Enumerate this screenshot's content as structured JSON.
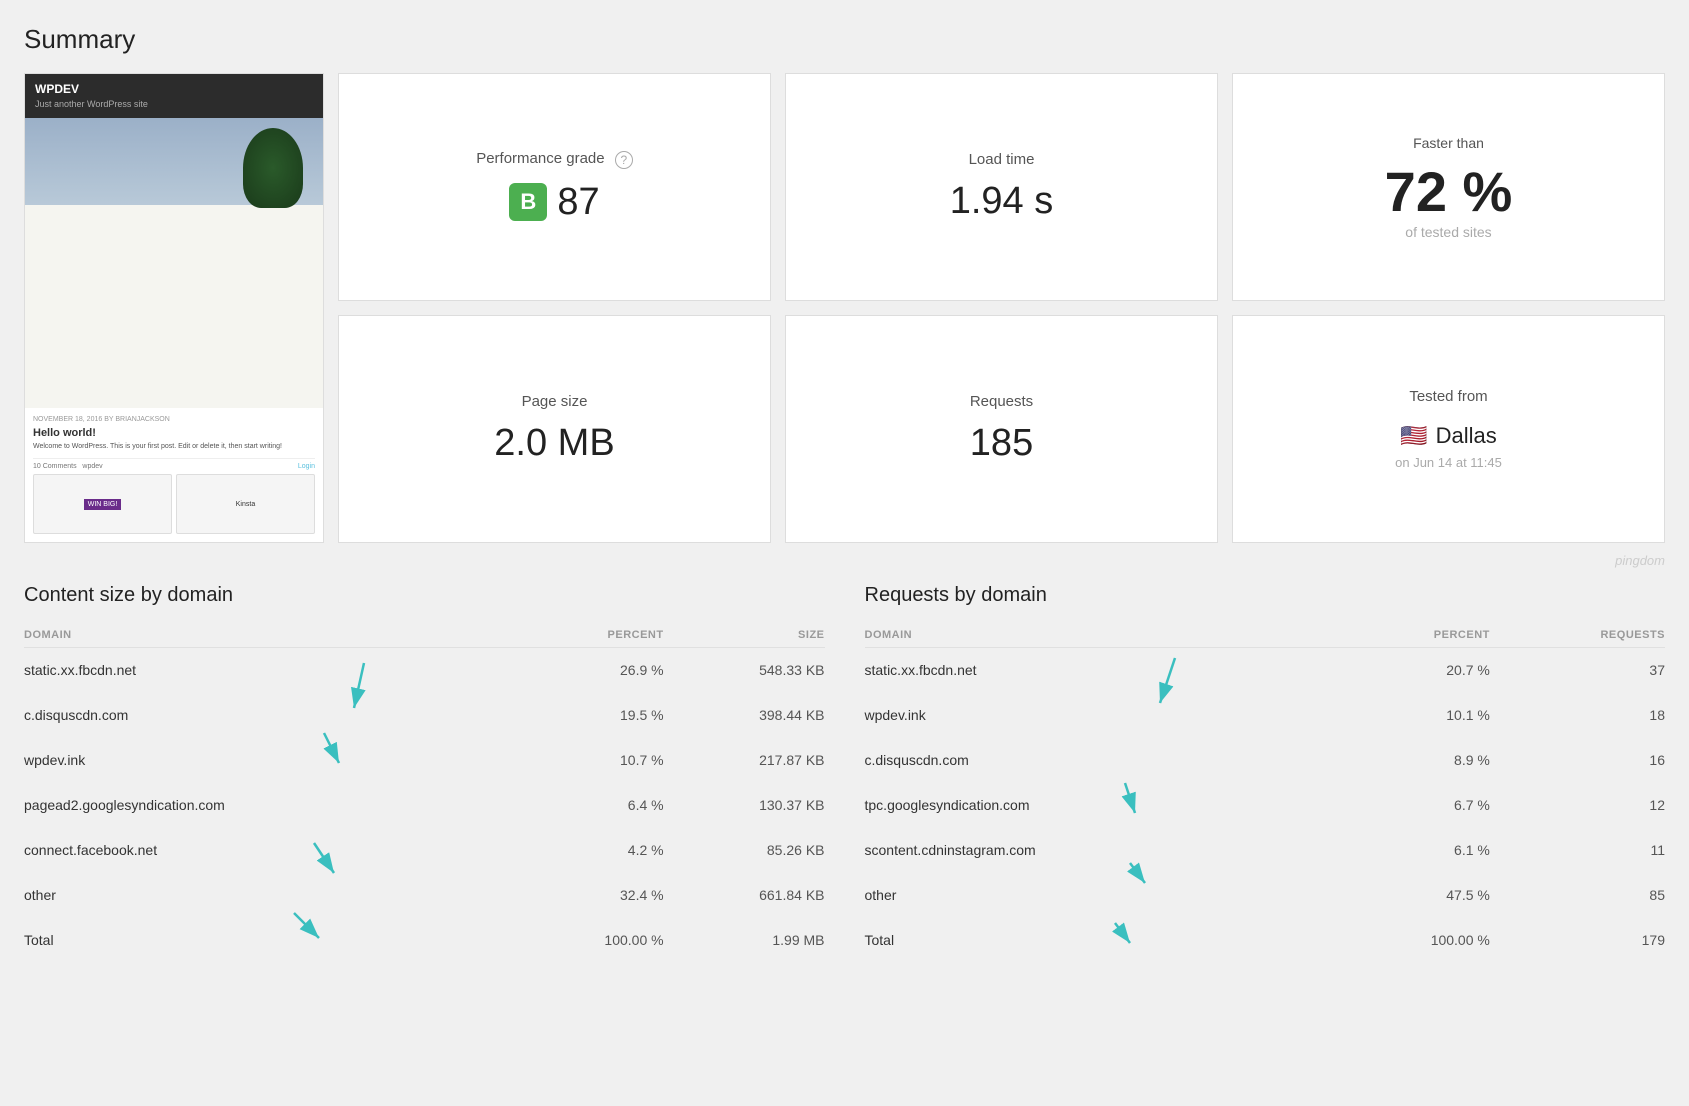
{
  "page": {
    "title": "Summary"
  },
  "metrics": {
    "performance_grade_label": "Performance grade",
    "performance_grade": "B",
    "performance_score": "87",
    "load_time_label": "Load time",
    "load_time": "1.94 s",
    "faster_than_label": "Faster than",
    "faster_than_pct": "72",
    "faster_than_sub": "of tested sites",
    "page_size_label": "Page size",
    "page_size": "2.0 MB",
    "requests_label": "Requests",
    "requests": "185",
    "tested_from_label": "Tested from",
    "tested_city": "Dallas",
    "tested_date": "on Jun 14 at 11:45",
    "question_mark": "?"
  },
  "pingdom": {
    "label": "pingdom"
  },
  "content_size": {
    "title": "Content size by domain",
    "columns": {
      "domain": "DOMAIN",
      "percent": "PERCENT",
      "size": "SIZE"
    },
    "rows": [
      {
        "domain": "static.xx.fbcdn.net",
        "percent": "26.9 %",
        "size": "548.33 KB"
      },
      {
        "domain": "c.disquscdn.com",
        "percent": "19.5 %",
        "size": "398.44 KB"
      },
      {
        "domain": "wpdev.ink",
        "percent": "10.7 %",
        "size": "217.87 KB"
      },
      {
        "domain": "pagead2.googlesyndication.com",
        "percent": "6.4 %",
        "size": "130.37 KB"
      },
      {
        "domain": "connect.facebook.net",
        "percent": "4.2 %",
        "size": "85.26 KB"
      },
      {
        "domain": "other",
        "percent": "32.4 %",
        "size": "661.84 KB"
      },
      {
        "domain": "Total",
        "percent": "100.00 %",
        "size": "1.99 MB"
      }
    ]
  },
  "requests_by_domain": {
    "title": "Requests by domain",
    "columns": {
      "domain": "DOMAIN",
      "percent": "PERCENT",
      "requests": "REQUESTS"
    },
    "rows": [
      {
        "domain": "static.xx.fbcdn.net",
        "percent": "20.7 %",
        "requests": "37"
      },
      {
        "domain": "wpdev.ink",
        "percent": "10.1 %",
        "requests": "18"
      },
      {
        "domain": "c.disquscdn.com",
        "percent": "8.9 %",
        "requests": "16"
      },
      {
        "domain": "tpc.googlesyndication.com",
        "percent": "6.7 %",
        "requests": "12"
      },
      {
        "domain": "scontent.cdninstagram.com",
        "percent": "6.1 %",
        "requests": "11"
      },
      {
        "domain": "other",
        "percent": "47.5 %",
        "requests": "85"
      },
      {
        "domain": "Total",
        "percent": "100.00 %",
        "requests": "179"
      }
    ]
  }
}
